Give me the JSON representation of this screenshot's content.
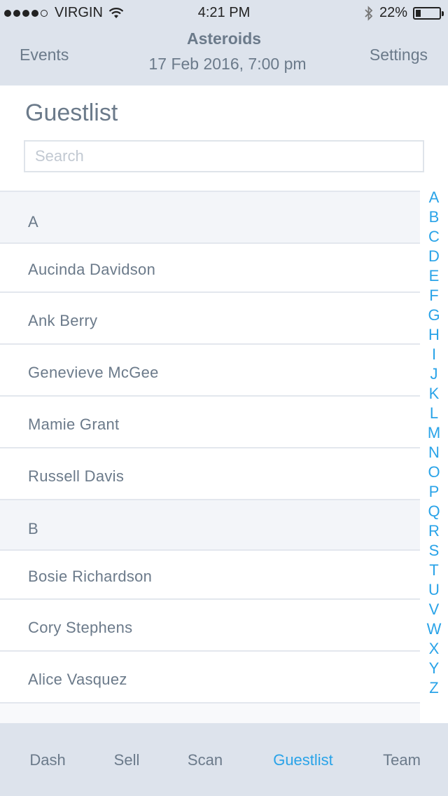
{
  "status_bar": {
    "carrier": "VIRGIN",
    "time": "4:21 PM",
    "battery": "22%",
    "battery_level": 0.22,
    "signal_bars": 4
  },
  "nav": {
    "left": "Events",
    "title": "Asteroids",
    "subtitle": "17 Feb 2016, 7:00 pm",
    "right": "Settings"
  },
  "page": {
    "heading": "Guestlist",
    "search_placeholder": "Search"
  },
  "guestlist": {
    "rows": [
      {
        "type": "header",
        "label": "A"
      },
      {
        "type": "guest",
        "label": "Aucinda Davidson"
      },
      {
        "type": "guest",
        "label": "Ank Berry"
      },
      {
        "type": "guest",
        "label": "Genevieve McGee"
      },
      {
        "type": "guest",
        "label": "Mamie Grant"
      },
      {
        "type": "guest",
        "label": "Russell Davis"
      },
      {
        "type": "header",
        "label": "B"
      },
      {
        "type": "guest",
        "label": "Bosie Richardson"
      },
      {
        "type": "guest",
        "label": "Cory Stephens"
      },
      {
        "type": "guest",
        "label": "Alice Vasquez"
      }
    ]
  },
  "index_letters": [
    "A",
    "B",
    "C",
    "D",
    "E",
    "F",
    "G",
    "H",
    "I",
    "J",
    "K",
    "L",
    "M",
    "N",
    "O",
    "P",
    "Q",
    "R",
    "S",
    "T",
    "U",
    "V",
    "W",
    "X",
    "Y",
    "Z"
  ],
  "tabs": [
    {
      "label": "Dash",
      "active": false
    },
    {
      "label": "Sell",
      "active": false
    },
    {
      "label": "Scan",
      "active": false
    },
    {
      "label": "Guestlist",
      "active": true
    },
    {
      "label": "Team",
      "active": false
    }
  ],
  "colors": {
    "accent": "#29a3e8",
    "bar_background": "#dde3ec",
    "text": "#6b7a8a"
  },
  "icons": [
    "wifi-icon",
    "bluetooth-icon",
    "battery-icon"
  ]
}
